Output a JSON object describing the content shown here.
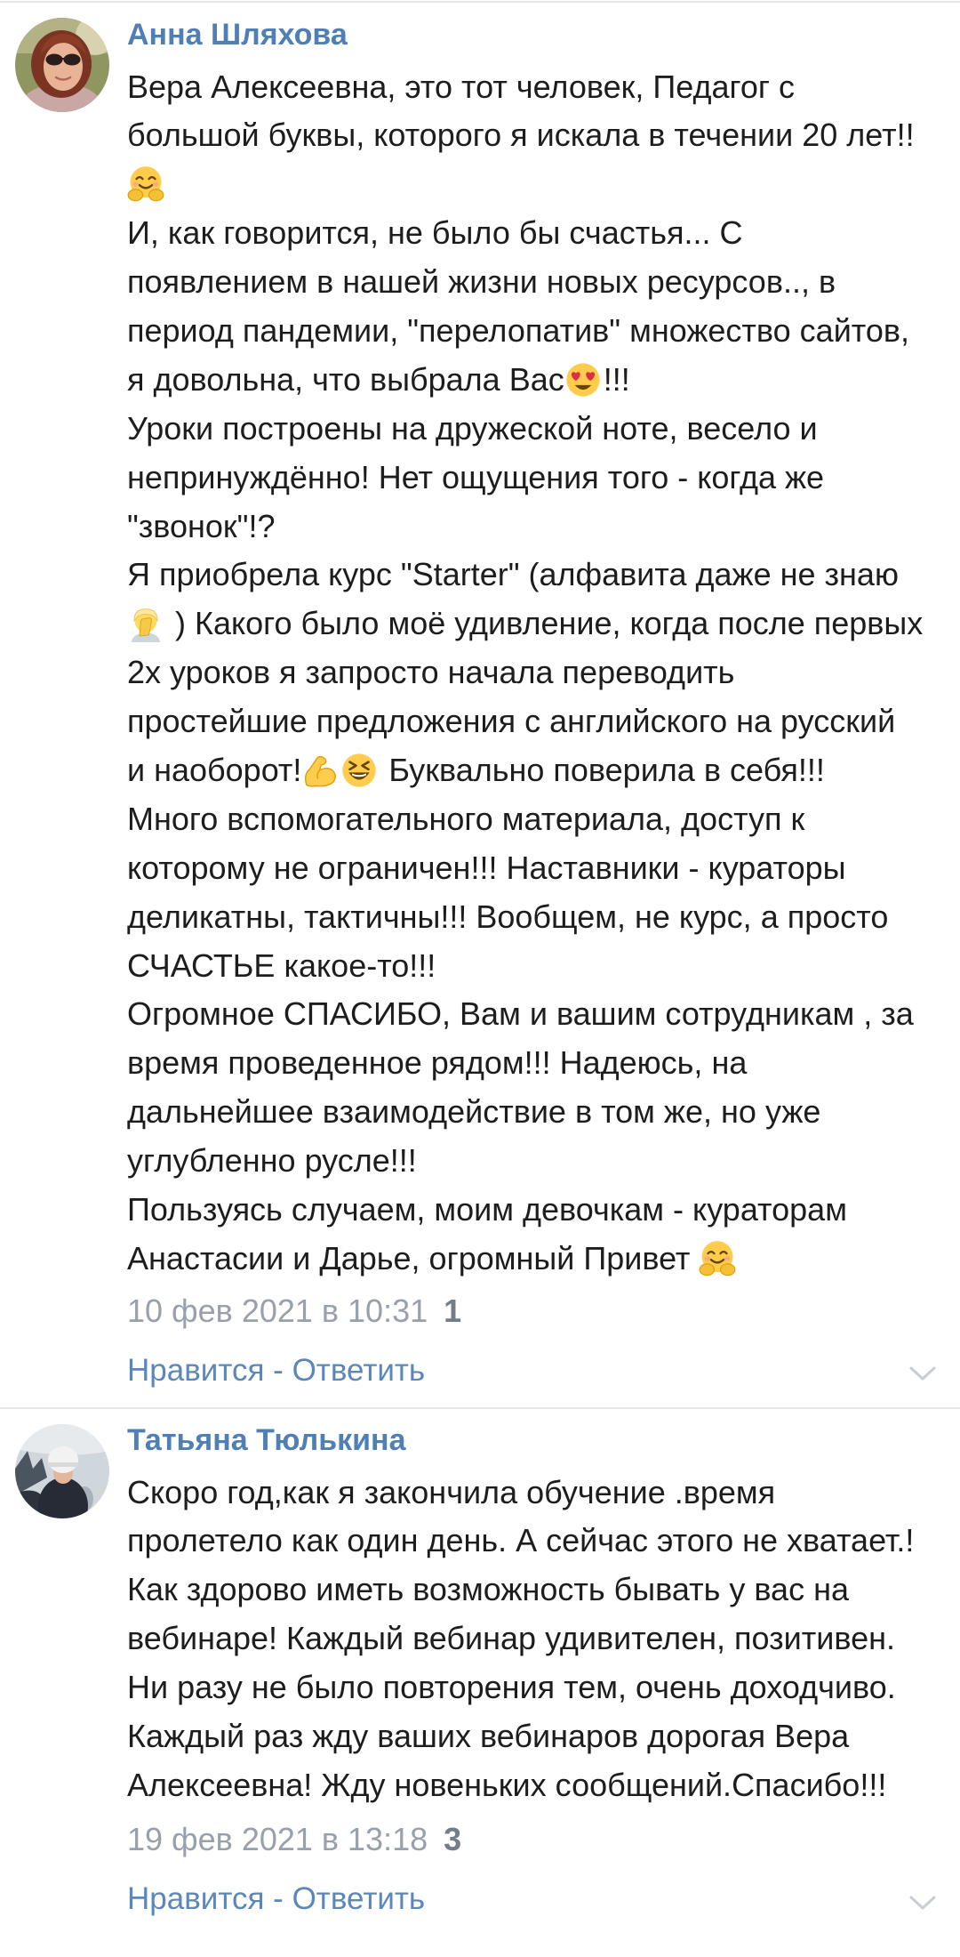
{
  "comments": [
    {
      "author": "Анна Шляхова",
      "lines": [
        [
          "Вера Алексеевна, это тот человек, Педагог с"
        ],
        [
          "большой буквы, которого я искала в течении 20 лет!!"
        ],
        [
          {
            "emoji": "hugging-face"
          }
        ],
        [
          "И, как говорится, не было бы счастья... С"
        ],
        [
          "появлением в нашей жизни новых ресурсов.., в"
        ],
        [
          "период пандемии, \"перелопатив\" множество сайтов,"
        ],
        [
          "я довольна, что выбрала Вас",
          {
            "emoji": "smiling-face-with-heart-eyes"
          },
          "!!!"
        ],
        [
          "Уроки построены на дружеской ноте, весело и"
        ],
        [
          "непринуждённо! Нет ощущения того - когда же"
        ],
        [
          "\"звонок\"!?"
        ],
        [
          "Я приобрела курс \"Starter\" (алфавита даже не знаю"
        ],
        [
          {
            "emoji": "person-facepalming"
          },
          " ) Какого было моё удивление, когда после первых"
        ],
        [
          "2х уроков я запросто начала переводить"
        ],
        [
          "простейшие предложения с английского на русский"
        ],
        [
          "и наоборот!",
          {
            "emoji": "flexed-biceps"
          },
          {
            "emoji": "grinning-squinting-face"
          },
          " Буквально поверила в себя!!!"
        ],
        [
          "Много вспомогательного материала, доступ к"
        ],
        [
          "которому не ограничен!!! Наставники - кураторы"
        ],
        [
          "деликатны, тактичны!!! Вообщем, не курс, а просто"
        ],
        [
          "СЧАСТЬЕ какое-то!!!"
        ],
        [
          "Огромное СПАСИБО, Вам и вашим сотрудникам , за"
        ],
        [
          "время проведенное рядом!!! Надеюсь, на"
        ],
        [
          "дальнейшее взаимодействие в том же, но уже"
        ],
        [
          "углубленно русле!!!"
        ],
        [
          "Пользуясь случаем, моим девочкам - кураторам"
        ],
        [
          "Анастасии и Дарье, огромный Привет ",
          {
            "emoji": "hugging-face"
          }
        ]
      ],
      "date": "10 фев 2021 в 10:31",
      "likes": "1",
      "like_label": "Нравится",
      "separator": " - ",
      "reply_label": "Ответить",
      "menu_icon": "chevron-down-icon"
    },
    {
      "author": "Татьяна Тюлькина",
      "lines": [
        [
          "Скоро год,как я закончила обучение .время"
        ],
        [
          "пролетело как один день. А сейчас этого не хватает.!"
        ],
        [
          "Как здорово иметь возможность бывать у вас на"
        ],
        [
          "вебинаре! Каждый вебинар удивителен, позитивен."
        ],
        [
          "Ни разу не было повторения тем, очень доходчиво."
        ],
        [
          "Каждый раз жду ваших вебинаров дорогая Вера"
        ],
        [
          "Алексеевна! Жду новеньких сообщений.Спасибо!!!"
        ]
      ],
      "date": "19 фев 2021 в 13:18",
      "likes": "3",
      "like_label": "Нравится",
      "separator": " - ",
      "reply_label": "Ответить",
      "menu_icon": "chevron-down-icon"
    }
  ],
  "colors": {
    "author_name": "#4f7fb4",
    "text": "#1d1d1d",
    "meta": "#98a0ab",
    "action_link": "#5b87ba",
    "divider": "#e4e6ea"
  }
}
